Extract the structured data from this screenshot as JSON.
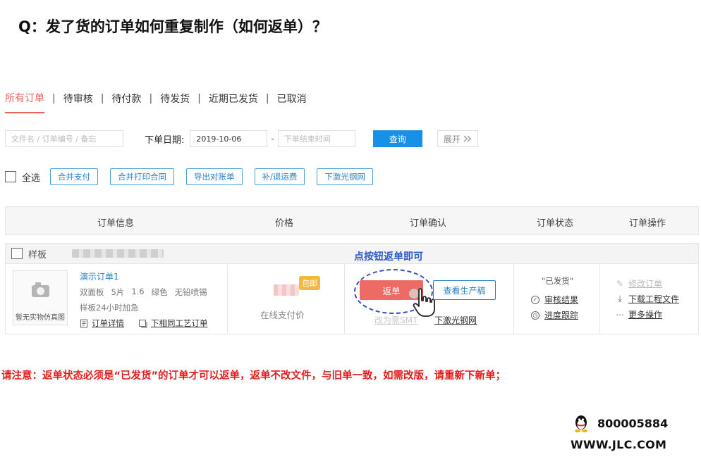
{
  "title": "Q：发了货的订单如何重复制作（如何返单）？",
  "tabs": [
    {
      "label": "所有订单",
      "active": true
    },
    {
      "label": "待审核",
      "active": false
    },
    {
      "label": "待付款",
      "active": false
    },
    {
      "label": "待发货",
      "active": false
    },
    {
      "label": "近期已发货",
      "active": false
    },
    {
      "label": "已取消",
      "active": false
    }
  ],
  "tab_separator": "|",
  "search": {
    "placeholder": "文件名 / 订单编号 / 备忘",
    "date_label": "下单日期:",
    "date_start": "2019-10-06",
    "date_dash": "-",
    "date_end_placeholder": "下单结束时间",
    "query_label": "查询",
    "expand_label": "展开"
  },
  "actions": {
    "select_all": "全选",
    "buttons": [
      "合并支付",
      "合并打印合同",
      "导出对账单",
      "补/退运费",
      "下激光钢网"
    ]
  },
  "table_headers": [
    "订单信息",
    "价格",
    "订单确认",
    "订单状态",
    "订单操作"
  ],
  "order": {
    "type_label": "样板",
    "thumbnail_text": "暂无实物仿真图",
    "name": "演示订单1",
    "specs": [
      "双面板",
      "5片",
      "1.6",
      "绿色",
      "无铅喷锡"
    ],
    "addon": "样板24小时加急",
    "link_detail": "订单详情",
    "link_same_process": "下相同工艺订单",
    "free_shipping_badge": "包邮",
    "price_note": "在线支付价",
    "annotation": "点按钮返单即可",
    "return_button": "返单",
    "view_production_button": "查看生产稿",
    "change_to_smt": "改为需SMT",
    "laser_stencil_link": "下激光钢网",
    "status": "\"已发货\"",
    "status_links": [
      "审核结果",
      "进度跟踪"
    ],
    "operations": [
      "修改订单",
      "下载工程文件",
      "更多操作"
    ]
  },
  "notice": "请注意：返单状态必须是“已发货”的订单才可以返单，返单不改文件，与旧单一致，如需改版，请重新下新单；",
  "contact": {
    "qq_number": "800005884",
    "website": "WWW.JLC.COM"
  },
  "colors": {
    "accent_tab": "#e8615c",
    "primary_blue": "#1890e8",
    "return_button": "#ee6a64",
    "badge": "#f3b83e",
    "notice_red": "#e31d1d",
    "annotation_blue": "#2a5cc5"
  }
}
